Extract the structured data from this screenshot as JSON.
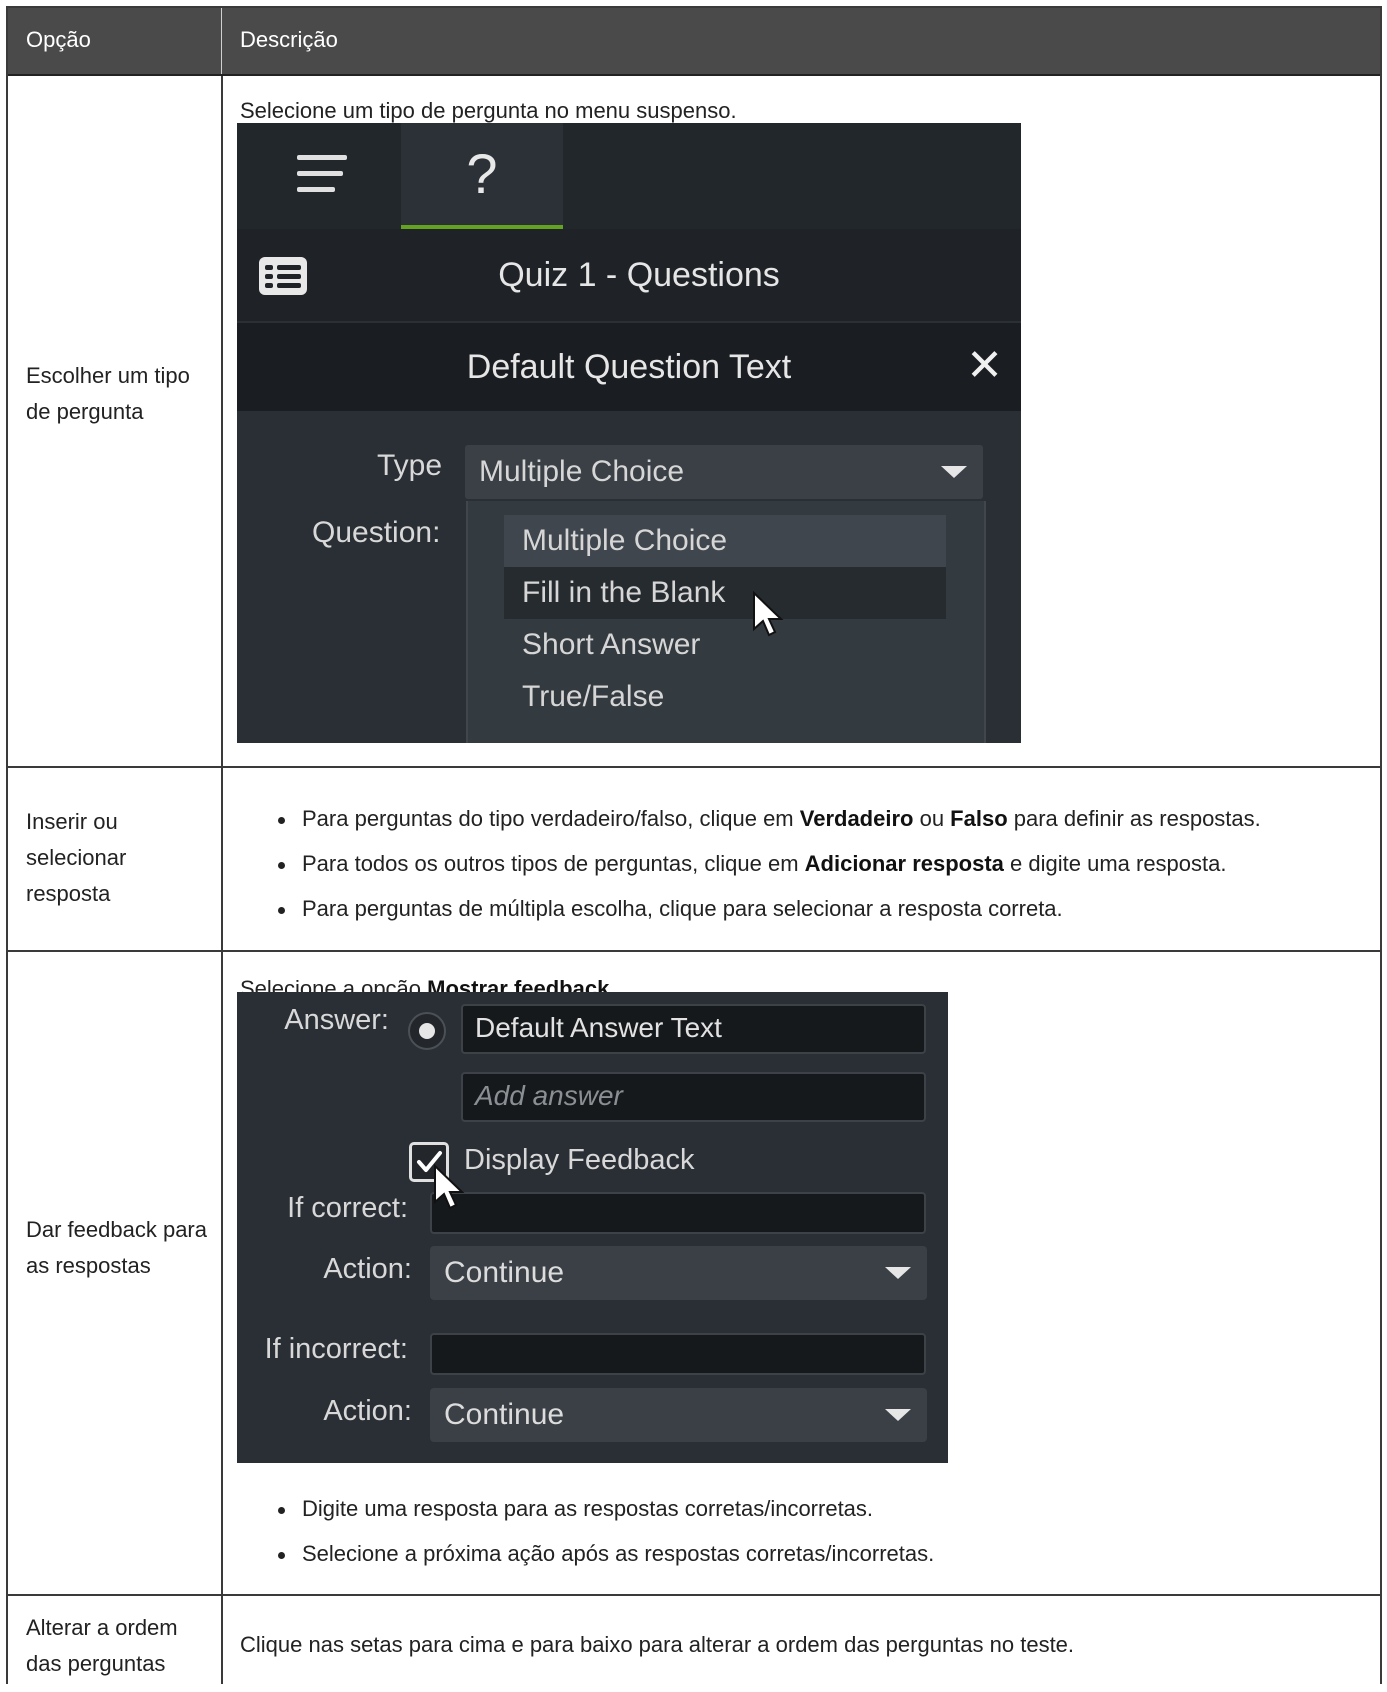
{
  "table": {
    "headers": {
      "option": "Opção",
      "description": "Descrição"
    },
    "rows": [
      {
        "option": "Escolher um tipo de pergunta",
        "intro": "Selecione um tipo de pergunta no menu suspenso.",
        "screenshot": {
          "tab_icons": [
            "menu-icon",
            "question-mark-icon"
          ],
          "question_mark": "?",
          "quiz_title": "Quiz 1 - Questions",
          "question_text": "Default Question Text",
          "close_glyph": "✕",
          "type_label": "Type",
          "type_value": "Multiple Choice",
          "question_label": "Question:",
          "dropdown_options": [
            "Multiple Choice",
            "Fill in the Blank",
            "Short Answer",
            "True/False"
          ],
          "selected_option": "Multiple Choice",
          "hovered_option": "Fill in the Blank"
        }
      },
      {
        "option": "Inserir ou selecionar resposta",
        "bullets": [
          {
            "pre": "Para perguntas do tipo verdadeiro/falso, clique em ",
            "b1": "Verdadeiro",
            "mid": " ou ",
            "b2": "Falso",
            "post": " para definir as respostas."
          },
          {
            "pre": "Para todos os outros tipos de perguntas, clique em ",
            "b1": "Adicionar resposta",
            "post": " e digite uma resposta."
          },
          {
            "text": "Para perguntas de múltipla escolha, clique para selecionar a resposta correta."
          }
        ]
      },
      {
        "option": "Dar feedback para as respostas",
        "intro_pre": "Selecione a opção ",
        "intro_bold": "Mostrar feedback",
        "intro_post": ".",
        "screenshot": {
          "answer_label": "Answer:",
          "answer_value": "Default Answer Text",
          "add_answer_placeholder": "Add answer",
          "display_feedback_label": "Display Feedback",
          "display_feedback_checked": true,
          "if_correct_label": "If correct:",
          "action_label_1": "Action:",
          "action_value_1": "Continue",
          "if_incorrect_label": "If incorrect:",
          "action_label_2": "Action:",
          "action_value_2": "Continue"
        },
        "bullets": [
          "Digite uma resposta para as respostas corretas/incorretas.",
          "Selecione a próxima ação após as respostas corretas/incorretas."
        ]
      },
      {
        "option": "Alterar a ordem das perguntas",
        "description": "Clique nas setas para cima e para baixo para alterar a ordem das perguntas no teste."
      }
    ]
  },
  "colors": {
    "header_bg": "#4a4a4a",
    "ui_panel": "#2a2f35",
    "active_tab_accent": "#63a31f"
  }
}
